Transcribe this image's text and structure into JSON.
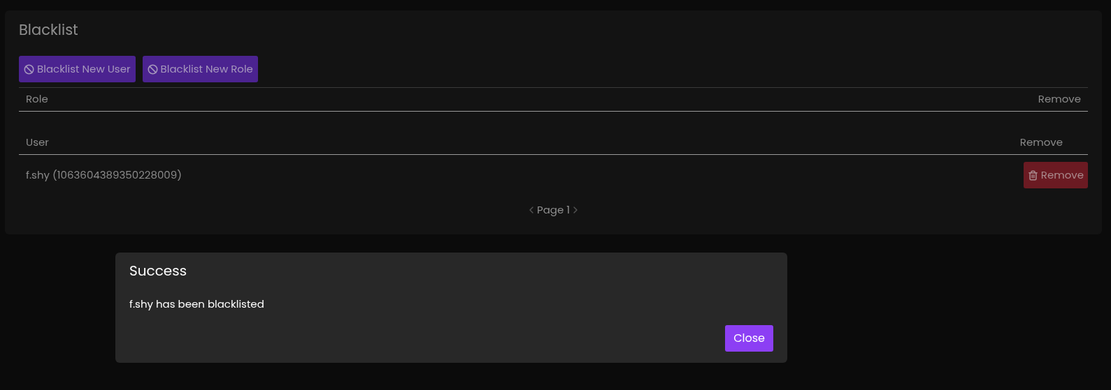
{
  "panel": {
    "title": "Blacklist",
    "actions": [
      {
        "label": "Blacklist New User"
      },
      {
        "label": "Blacklist New Role"
      }
    ],
    "role_table": {
      "columns": [
        "Role",
        "Remove"
      ]
    },
    "user_table": {
      "columns": [
        "User",
        "Remove"
      ],
      "rows": [
        {
          "user": "f.shy (1063604389350228009)",
          "action": "Remove"
        }
      ]
    },
    "pagination": {
      "label": "Page 1"
    }
  },
  "dialog": {
    "title": "Success",
    "message": "f.shy has been blacklisted",
    "button": "Close"
  }
}
